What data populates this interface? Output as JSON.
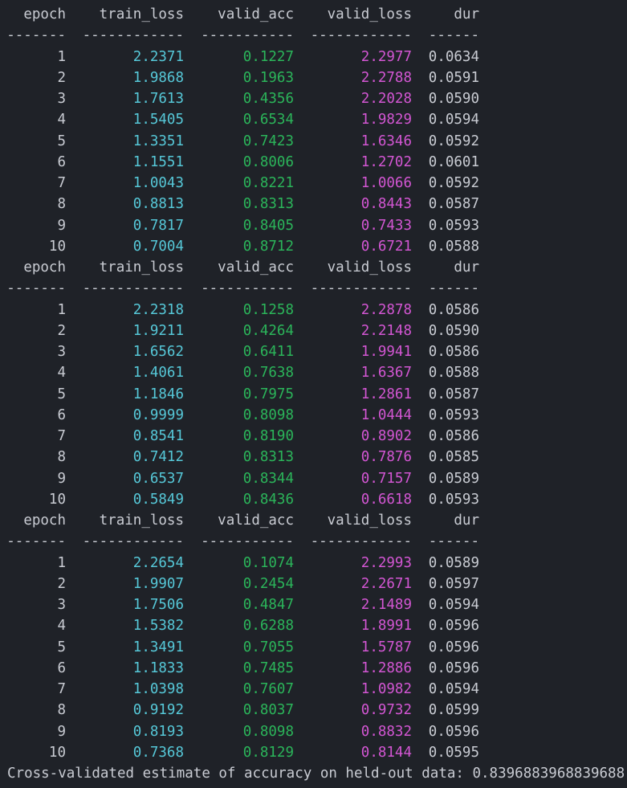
{
  "columns": [
    "epoch",
    "train_loss",
    "valid_acc",
    "valid_loss",
    "dur"
  ],
  "separators": [
    "-------",
    "------------",
    "-----------",
    "------------",
    "------"
  ],
  "folds": [
    {
      "rows": [
        [
          "1",
          "2.2371",
          "0.1227",
          "2.2977",
          "0.0634"
        ],
        [
          "2",
          "1.9868",
          "0.1963",
          "2.2788",
          "0.0591"
        ],
        [
          "3",
          "1.7613",
          "0.4356",
          "2.2028",
          "0.0590"
        ],
        [
          "4",
          "1.5405",
          "0.6534",
          "1.9829",
          "0.0594"
        ],
        [
          "5",
          "1.3351",
          "0.7423",
          "1.6346",
          "0.0592"
        ],
        [
          "6",
          "1.1551",
          "0.8006",
          "1.2702",
          "0.0601"
        ],
        [
          "7",
          "1.0043",
          "0.8221",
          "1.0066",
          "0.0592"
        ],
        [
          "8",
          "0.8813",
          "0.8313",
          "0.8443",
          "0.0587"
        ],
        [
          "9",
          "0.7817",
          "0.8405",
          "0.7433",
          "0.0593"
        ],
        [
          "10",
          "0.7004",
          "0.8712",
          "0.6721",
          "0.0588"
        ]
      ]
    },
    {
      "rows": [
        [
          "1",
          "2.2318",
          "0.1258",
          "2.2878",
          "0.0586"
        ],
        [
          "2",
          "1.9211",
          "0.4264",
          "2.2148",
          "0.0590"
        ],
        [
          "3",
          "1.6562",
          "0.6411",
          "1.9941",
          "0.0586"
        ],
        [
          "4",
          "1.4061",
          "0.7638",
          "1.6367",
          "0.0588"
        ],
        [
          "5",
          "1.1846",
          "0.7975",
          "1.2861",
          "0.0587"
        ],
        [
          "6",
          "0.9999",
          "0.8098",
          "1.0444",
          "0.0593"
        ],
        [
          "7",
          "0.8541",
          "0.8190",
          "0.8902",
          "0.0586"
        ],
        [
          "8",
          "0.7412",
          "0.8313",
          "0.7876",
          "0.0585"
        ],
        [
          "9",
          "0.6537",
          "0.8344",
          "0.7157",
          "0.0589"
        ],
        [
          "10",
          "0.5849",
          "0.8436",
          "0.6618",
          "0.0593"
        ]
      ]
    },
    {
      "rows": [
        [
          "1",
          "2.2654",
          "0.1074",
          "2.2993",
          "0.0589"
        ],
        [
          "2",
          "1.9907",
          "0.2454",
          "2.2671",
          "0.0597"
        ],
        [
          "3",
          "1.7506",
          "0.4847",
          "2.1489",
          "0.0594"
        ],
        [
          "4",
          "1.5382",
          "0.6288",
          "1.8991",
          "0.0596"
        ],
        [
          "5",
          "1.3491",
          "0.7055",
          "1.5787",
          "0.0596"
        ],
        [
          "6",
          "1.1833",
          "0.7485",
          "1.2886",
          "0.0596"
        ],
        [
          "7",
          "1.0398",
          "0.7607",
          "1.0982",
          "0.0594"
        ],
        [
          "8",
          "0.9192",
          "0.8037",
          "0.9732",
          "0.0599"
        ],
        [
          "9",
          "0.8193",
          "0.8098",
          "0.8832",
          "0.0596"
        ],
        [
          "10",
          "0.7368",
          "0.8129",
          "0.8144",
          "0.0595"
        ]
      ]
    }
  ],
  "summary": "Cross-validated estimate of accuracy on held-out data: 0.8396883968839688",
  "colors": {
    "background": "#1f2228",
    "text": "#c9ccd3",
    "train_loss": "#56c8d8",
    "valid_acc": "#2bb55a",
    "valid_loss": "#d356d3"
  }
}
